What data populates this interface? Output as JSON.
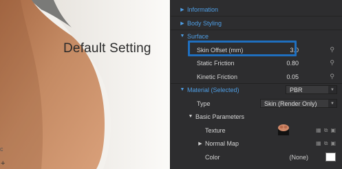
{
  "viewport": {
    "overlay_label": "Default Setting",
    "corner_mark": "+",
    "left_mark": "c"
  },
  "panel": {
    "sections": {
      "information": "Information",
      "body_styling": "Body Styling",
      "surface": "Surface",
      "material": "Material (Selected)",
      "basic_parameters": "Basic Parameters"
    },
    "surface": {
      "skin_offset_label": "Skin Offset (mm)",
      "skin_offset_value": "3.0",
      "static_friction_label": "Static Friction",
      "static_friction_value": "0.80",
      "kinetic_friction_label": "Kinetic Friction",
      "kinetic_friction_value": "0.05"
    },
    "material": {
      "shader_value": "PBR",
      "type_label": "Type",
      "type_value": "Skin (Render Only)",
      "texture_label": "Texture",
      "normal_map_label": "Normal Map",
      "color_label": "Color",
      "color_value": "(None)",
      "color_swatch": "#ffffff"
    },
    "colors": {
      "background": "#2d2d2f",
      "section_text": "#4f9fe6",
      "highlight_border": "#1f6fbf"
    },
    "icons": {
      "pin": "pin-icon",
      "collapse": "caret-down-icon",
      "expand": "caret-right-icon"
    }
  }
}
